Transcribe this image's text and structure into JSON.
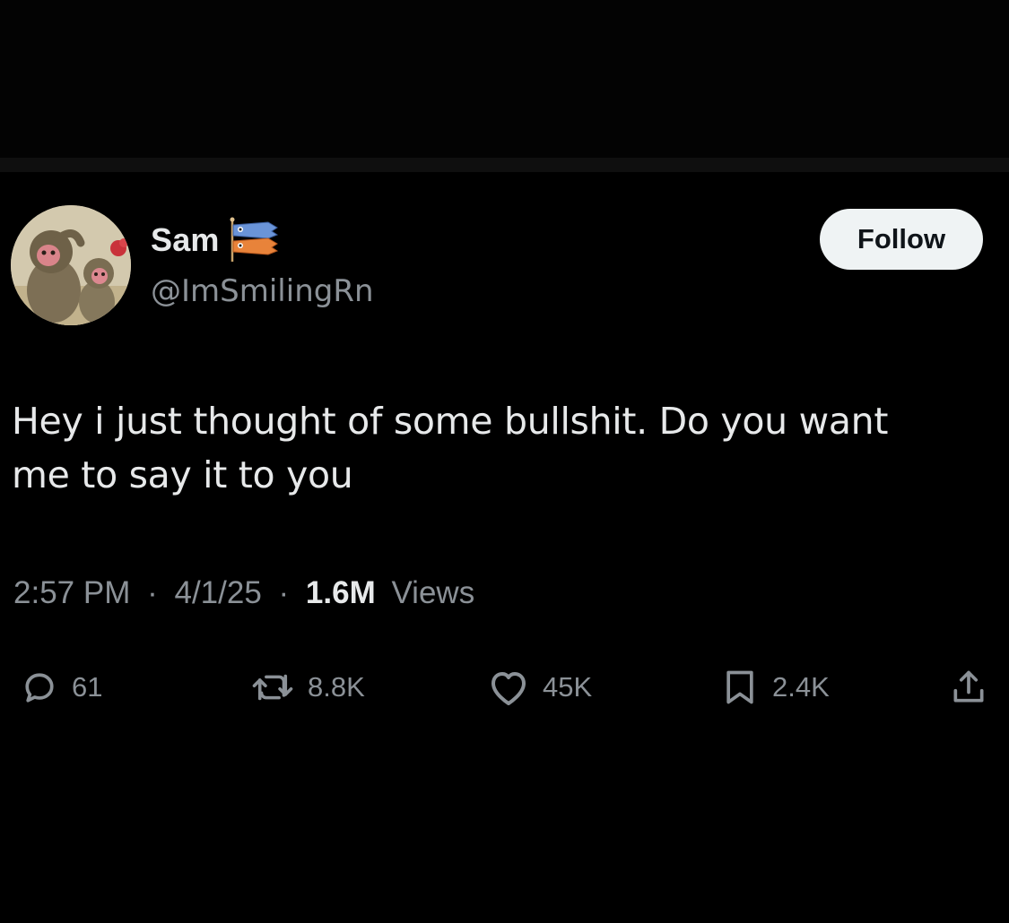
{
  "author": {
    "display_name": "Sam",
    "handle": "@ImSmilingRn",
    "name_emoji": "koinobori-icon",
    "avatar": "monkey-illustration-avatar"
  },
  "follow_button": {
    "label": "Follow"
  },
  "tweet": {
    "text_line1": "Hey i just thought of some bullshit. Do you want",
    "text_line2": "me to say it to you"
  },
  "meta": {
    "time": "2:57 PM",
    "date": "4/1/25",
    "separator": "·",
    "views_count": "1.6M",
    "views_label": "Views"
  },
  "actions": {
    "reply": {
      "icon": "reply-icon",
      "count": "61"
    },
    "retweet": {
      "icon": "retweet-icon",
      "count": "8.8K"
    },
    "like": {
      "icon": "heart-icon",
      "count": "45K"
    },
    "bookmark": {
      "icon": "bookmark-icon",
      "count": "2.4K"
    },
    "share": {
      "icon": "share-icon"
    }
  },
  "colors": {
    "background": "#000000",
    "primary_text": "#e7e9ea",
    "secondary_text": "#8b9197",
    "follow_button_bg": "#eff3f4",
    "follow_button_text": "#0f1419"
  }
}
